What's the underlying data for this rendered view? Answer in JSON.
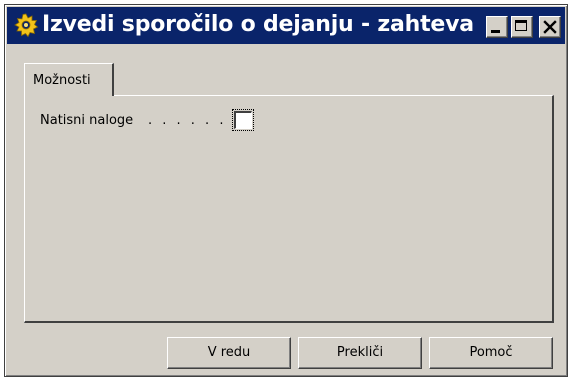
{
  "window": {
    "title": "Izvedi sporočilo o dejanju - zahteva",
    "icon": "gear-icon"
  },
  "titlebar_buttons": {
    "minimize_icon": "minimize-icon",
    "maximize_icon": "maximize-icon",
    "close_icon": "close-icon"
  },
  "tabs": [
    {
      "label": "Možnosti",
      "active": true
    }
  ],
  "options": {
    "print_orders_label": "Natisni naloge",
    "print_orders_dots": ". . . . . .",
    "print_orders_checked": false
  },
  "buttons": {
    "ok": "V redu",
    "cancel": "Prekliči",
    "help": "Pomoč"
  },
  "colors": {
    "titlebar": "#0a246a",
    "face": "#d4d0c8"
  }
}
